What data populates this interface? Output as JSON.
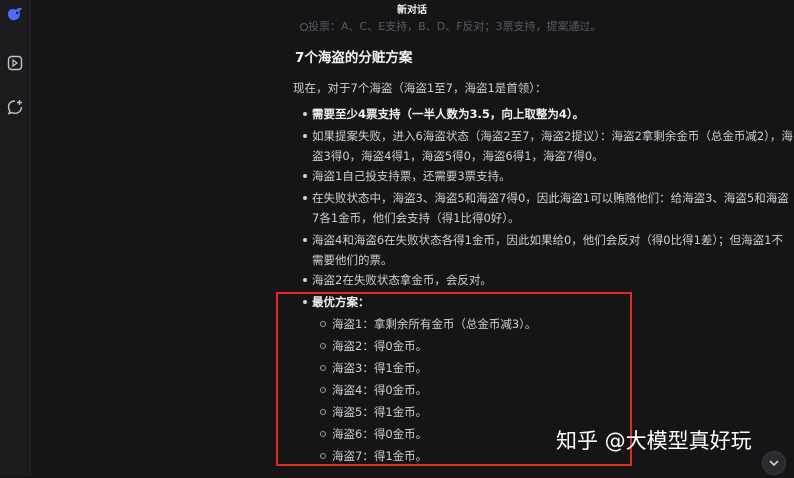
{
  "header": {
    "title": "新对话"
  },
  "prev_line": "投票：A、C、E支持，B、D、F反对；3票支持，提案通过。",
  "section": {
    "heading": "7个海盗的分赃方案",
    "intro": "现在，对于7个海盗（海盗1至7，海盗1是首领）：",
    "bullets": [
      {
        "text": "需要至少4票支持（一半人数为3.5，向上取整为4）。",
        "bold": true
      },
      {
        "text": "如果提案失败，进入6海盗状态（海盗2至7，海盗2提议）：海盗2拿剩余金币（总金币减2），海盗3得0，海盗4得1，海盗5得0，海盗6得1，海盗7得0。"
      },
      {
        "text": "海盗1自己投支持票，还需要3票支持。"
      },
      {
        "text": "在失败状态中，海盗3、海盗5和海盗7得0，因此海盗1可以贿赂他们：给海盗3、海盗5和海盗7各1金币，他们会支持（得1比得0好）。"
      },
      {
        "text": "海盗4和海盗6在失败状态各得1金币，因此如果给0，他们会反对（得0比得1差）；但海盗1不需要他们的票。"
      },
      {
        "text": "海盗2在失败状态拿金币，会反对。"
      }
    ],
    "optimal": {
      "label": "最优方案：",
      "items": [
        "海盗1：拿剩余所有金币（总金币减3）。",
        "海盗2：得0金币。",
        "海盗3：得1金币。",
        "海盗4：得0金币。",
        "海盗5：得1金币。",
        "海盗6：得0金币。",
        "海盗7：得1金币。"
      ]
    }
  },
  "watermark": "知乎 @大模型真好玩",
  "colors": {
    "background": "#151517",
    "highlight_box": "#e0291f"
  },
  "icons": [
    "deepseek-logo-icon",
    "sidebar-toggle-icon",
    "new-chat-icon",
    "chevron-down-icon"
  ]
}
